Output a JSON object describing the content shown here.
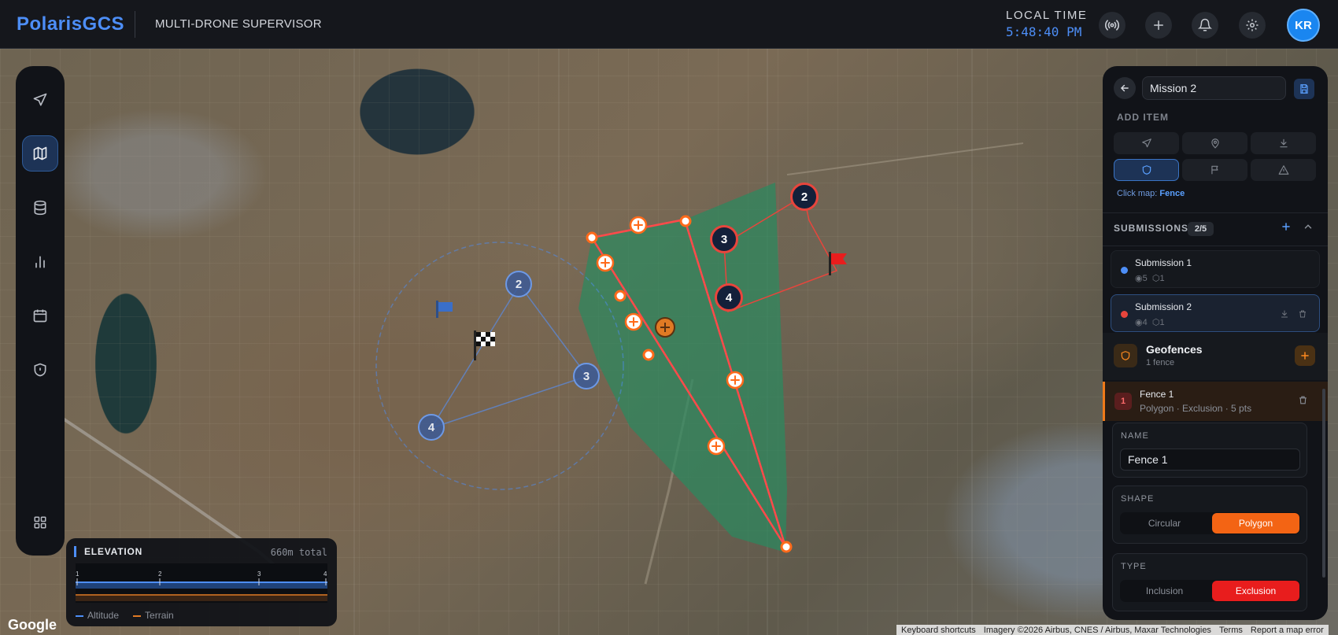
{
  "app": {
    "logo": "PolarisGCS",
    "subtitle": "MULTI-DRONE SUPERVISOR",
    "local_time_label": "LOCAL TIME",
    "local_time": "5:48:40 PM",
    "avatar_initials": "KR",
    "accent": "#4d8ef7"
  },
  "toolbar": {
    "icons": [
      "broadcast-icon",
      "plus-icon",
      "bell-icon",
      "gear-icon"
    ]
  },
  "rail": {
    "items": [
      {
        "icon": "drone-plane-icon",
        "active": false
      },
      {
        "icon": "map-icon",
        "active": true
      },
      {
        "icon": "database-icon",
        "active": false
      },
      {
        "icon": "bar-chart-icon",
        "active": false
      },
      {
        "icon": "calendar-icon",
        "active": false
      },
      {
        "icon": "shield-icon",
        "active": false
      },
      {
        "icon": "grid-apps-icon",
        "active": false
      }
    ]
  },
  "map": {
    "waypoints_primary": [
      "2",
      "3",
      "4"
    ],
    "waypoints_secondary": [
      "2",
      "3",
      "4"
    ],
    "geofence_color": "#ff4a4a",
    "fill_color": "#2a8a5f"
  },
  "elevation": {
    "title": "ELEVATION",
    "total": "660m total",
    "ticks": [
      "1",
      "2",
      "3",
      "4"
    ],
    "legend_altitude": "Altitude",
    "legend_terrain": "Terrain",
    "altitude_color": "#4d8ef7",
    "terrain_color": "#e07a24"
  },
  "footer": {
    "google": "Google",
    "keyboard": "Keyboard shortcuts",
    "imagery": "Imagery ©2026 Airbus, CNES / Airbus, Maxar Technologies",
    "terms": "Terms",
    "report": "Report a map error"
  },
  "panel": {
    "mission_name": "Mission 2",
    "add_item_label": "ADD ITEM",
    "add_items": [
      {
        "icon": "takeoff-icon",
        "active": false
      },
      {
        "icon": "location-pin-icon",
        "active": false
      },
      {
        "icon": "land-icon",
        "active": false
      },
      {
        "icon": "shield-outline-icon",
        "active": true
      },
      {
        "icon": "flag-icon",
        "active": false
      },
      {
        "icon": "warning-icon",
        "active": false
      }
    ],
    "click_hint_prefix": "Click map:",
    "click_hint_value": "Fence",
    "submissions_label": "SUBMISSIONS",
    "submissions_count": "2/5",
    "submissions": [
      {
        "name": "Submission 1",
        "waypoints": "5",
        "fences": "1",
        "color": "#4d8ef7",
        "selected": false
      },
      {
        "name": "Submission 2",
        "waypoints": "4",
        "fences": "1",
        "color": "#e8453c",
        "selected": true
      }
    ],
    "geofences_title": "Geofences",
    "geofences_sub": "1 fence",
    "fence": {
      "index": "1",
      "name": "Fence 1",
      "meta": "Polygon · Exclusion · 5 pts"
    },
    "name_label": "NAME",
    "name_value": "Fence 1",
    "shape_label": "SHAPE",
    "shape_options": [
      "Circular",
      "Polygon"
    ],
    "shape_selected": "Polygon",
    "type_label": "TYPE",
    "type_options": [
      "Inclusion",
      "Exclusion"
    ],
    "type_selected": "Exclusion"
  }
}
